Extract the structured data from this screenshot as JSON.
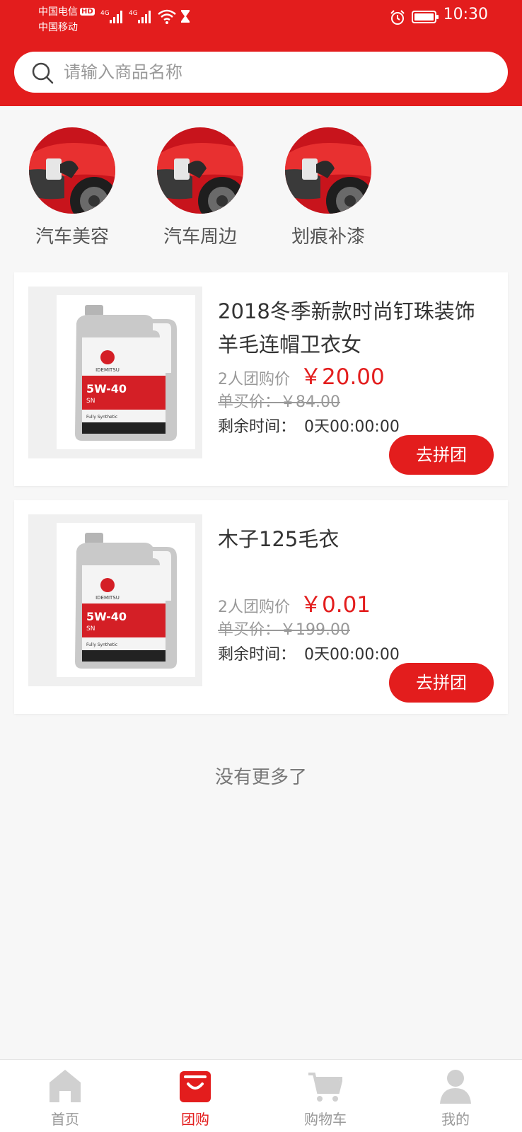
{
  "status_bar": {
    "carrier_1": "中国电信",
    "carrier_1_badge": "HD",
    "carrier_2": "中国移动",
    "network_1": "4G",
    "network_2": "4G",
    "time": "10:30"
  },
  "search": {
    "placeholder": "请输入商品名称"
  },
  "categories": [
    {
      "label": "汽车美容"
    },
    {
      "label": "汽车周边"
    },
    {
      "label": "划痕补漆"
    }
  ],
  "products": [
    {
      "title": "2018冬季新款时尚钉珠装饰羊毛连帽卫衣女",
      "group_label": "2人团购价",
      "group_price": "￥20.00",
      "orig_price": "单买价：￥84.00",
      "time_label": "剩余时间：",
      "time_value": "0天00:00:00",
      "button": "去拼团"
    },
    {
      "title": "木子125毛衣",
      "group_label": "2人团购价",
      "group_price": "￥0.01",
      "orig_price": "单买价：￥199.00",
      "time_label": "剩余时间：",
      "time_value": "0天00:00:00",
      "button": "去拼团"
    }
  ],
  "product_image": {
    "brand": "IDEMITSU",
    "grade": "5W-40",
    "spec": "SN",
    "type": "Fully Synthetic"
  },
  "footer_note": "没有更多了",
  "tabbar": [
    {
      "label": "首页",
      "icon": "home-icon",
      "active": false
    },
    {
      "label": "团购",
      "icon": "shopping-bag-icon",
      "active": true
    },
    {
      "label": "购物车",
      "icon": "cart-icon",
      "active": false
    },
    {
      "label": "我的",
      "icon": "user-icon",
      "active": false
    }
  ],
  "colors": {
    "brand_red": "#e31d1d",
    "background": "#f7f7f7",
    "muted_text": "#999999",
    "tab_inactive_icon": "#d0d0d0"
  }
}
